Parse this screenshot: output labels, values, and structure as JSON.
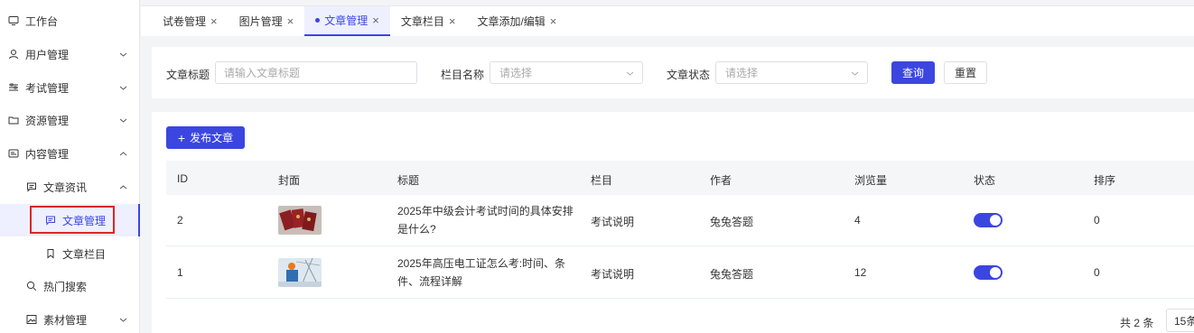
{
  "sidebar": {
    "items": [
      {
        "label": "工作台"
      },
      {
        "label": "用户管理"
      },
      {
        "label": "考试管理"
      },
      {
        "label": "资源管理"
      },
      {
        "label": "内容管理"
      },
      {
        "label": "文章资讯"
      },
      {
        "label": "文章管理"
      },
      {
        "label": "文章栏目"
      },
      {
        "label": "热门搜索"
      },
      {
        "label": "素材管理"
      }
    ]
  },
  "tabs": [
    {
      "label": "试卷管理"
    },
    {
      "label": "图片管理"
    },
    {
      "label": "文章管理"
    },
    {
      "label": "文章栏目"
    },
    {
      "label": "文章添加/编辑"
    }
  ],
  "filter": {
    "title_label": "文章标题",
    "title_placeholder": "请输入文章标题",
    "column_label": "栏目名称",
    "column_placeholder": "请选择",
    "status_label": "文章状态",
    "status_placeholder": "请选择",
    "query_button": "查询",
    "reset_button": "重置"
  },
  "toolbar": {
    "publish_button": "发布文章"
  },
  "table": {
    "columns": [
      "ID",
      "封面",
      "标题",
      "栏目",
      "作者",
      "浏览量",
      "状态",
      "排序"
    ],
    "rows": [
      {
        "id": "2",
        "title": "2025年中级会计考试时间的具体安排是什么?",
        "column": "考试说明",
        "author": "兔兔答题",
        "views": "4",
        "status_on": true,
        "sort": "0"
      },
      {
        "id": "1",
        "title": "2025年高压电工证怎么考:时间、条件、流程详解",
        "column": "考试说明",
        "author": "兔兔答题",
        "views": "12",
        "status_on": true,
        "sort": "0"
      }
    ]
  },
  "pagination": {
    "total": "共 2 条",
    "page_size": "15条"
  },
  "colors": {
    "accent": "#3b46e0",
    "highlight_box": "#e02424"
  }
}
